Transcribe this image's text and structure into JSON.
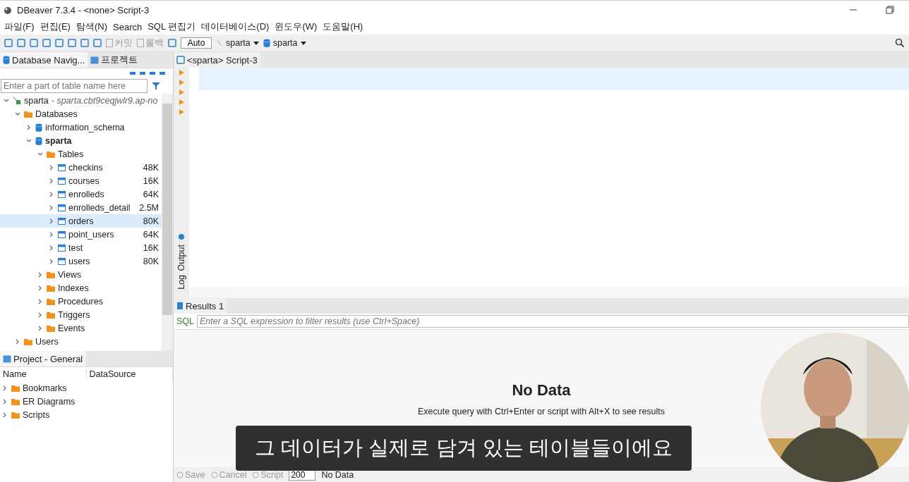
{
  "window": {
    "title": "DBeaver 7.3.4 - <none> Script-3"
  },
  "menu": [
    "파일(F)",
    "편집(E)",
    "탐색(N)",
    "Search",
    "SQL 편집기",
    "데이터베이스(D)",
    "윈도우(W)",
    "도움말(H)"
  ],
  "toolbar": [
    {
      "kind": "action",
      "label": "커밋",
      "disabled": true
    },
    {
      "kind": "action",
      "label": "롤백",
      "disabled": true
    },
    {
      "kind": "field",
      "value": "Auto"
    },
    {
      "kind": "combo",
      "label": "sparta"
    },
    {
      "kind": "combo",
      "label": "sparta"
    }
  ],
  "navigator": {
    "tabs": [
      {
        "label": "Database Navig...",
        "selected": true
      },
      {
        "label": "프로젝트",
        "selected": false
      }
    ],
    "filter": {
      "placeholder": "Enter a part of table name here"
    },
    "tree": [
      {
        "kind": "connection",
        "label": "sparta",
        "detail": "- sparta.cbt9ceqjwlr9.ap-no",
        "expanded": true,
        "selected": false,
        "children": [
          {
            "kind": "folder",
            "label": "Databases",
            "expanded": true,
            "selected": false,
            "children": [
              {
                "kind": "database",
                "label": "information_schema",
                "expanded": false,
                "selected": false
              },
              {
                "kind": "database",
                "label": "sparta",
                "bold": true,
                "expanded": true,
                "selected": false,
                "children": [
                  {
                    "kind": "folder",
                    "label": "Tables",
                    "expanded": true,
                    "selected": false,
                    "children": [
                      {
                        "kind": "table",
                        "label": "checkins",
                        "size": "48K",
                        "expanded": false,
                        "selected": false
                      },
                      {
                        "kind": "table",
                        "label": "courses",
                        "size": "16K",
                        "expanded": false,
                        "selected": false
                      },
                      {
                        "kind": "table",
                        "label": "enrolleds",
                        "size": "64K",
                        "expanded": false,
                        "selected": false
                      },
                      {
                        "kind": "table",
                        "label": "enrolleds_detail",
                        "size": "2.5M",
                        "expanded": false,
                        "selected": false
                      },
                      {
                        "kind": "table",
                        "label": "orders",
                        "size": "80K",
                        "expanded": false,
                        "selected": true
                      },
                      {
                        "kind": "table",
                        "label": "point_users",
                        "size": "64K",
                        "expanded": false,
                        "selected": false
                      },
                      {
                        "kind": "table",
                        "label": "test",
                        "size": "16K",
                        "expanded": false,
                        "selected": false
                      },
                      {
                        "kind": "table",
                        "label": "users",
                        "size": "80K",
                        "expanded": false,
                        "selected": false
                      }
                    ]
                  },
                  {
                    "kind": "folder",
                    "label": "Views",
                    "expanded": false,
                    "selected": false
                  },
                  {
                    "kind": "folder",
                    "label": "Indexes",
                    "expanded": false,
                    "selected": false
                  },
                  {
                    "kind": "folder",
                    "label": "Procedures",
                    "expanded": false,
                    "selected": false
                  },
                  {
                    "kind": "folder",
                    "label": "Triggers",
                    "expanded": false,
                    "selected": false
                  },
                  {
                    "kind": "folder",
                    "label": "Events",
                    "expanded": false,
                    "selected": false
                  }
                ]
              }
            ]
          },
          {
            "kind": "folder",
            "label": "Users",
            "expanded": false,
            "selected": false
          }
        ]
      }
    ]
  },
  "project": {
    "title": "Project - General",
    "columns": [
      "Name",
      "DataSource"
    ],
    "items": [
      {
        "label": "Bookmarks",
        "expanded": false
      },
      {
        "label": "ER Diagrams",
        "expanded": false
      },
      {
        "label": "Scripts",
        "expanded": false
      }
    ]
  },
  "editor": {
    "tab": "<sparta> Script-3",
    "side_tabs": [
      "Output",
      "Log"
    ]
  },
  "results": {
    "tab": "Results 1",
    "filter_label": "SQL",
    "filter": {
      "placeholder": "Enter a SQL expression to filter results (use Ctrl+Space)"
    },
    "empty_title": "No Data",
    "empty_hint": "Execute query with Ctrl+Enter or script with Alt+X to see results"
  },
  "status_bar": {
    "actions": [
      {
        "label": "Save",
        "disabled": true
      },
      {
        "label": "Cancel",
        "disabled": true
      },
      {
        "label": "Script",
        "disabled": true
      }
    ],
    "row_limit": "200",
    "message": "No Data"
  },
  "subtitle": "그 데이터가 실제로 담겨 있는 테이블들이에요"
}
